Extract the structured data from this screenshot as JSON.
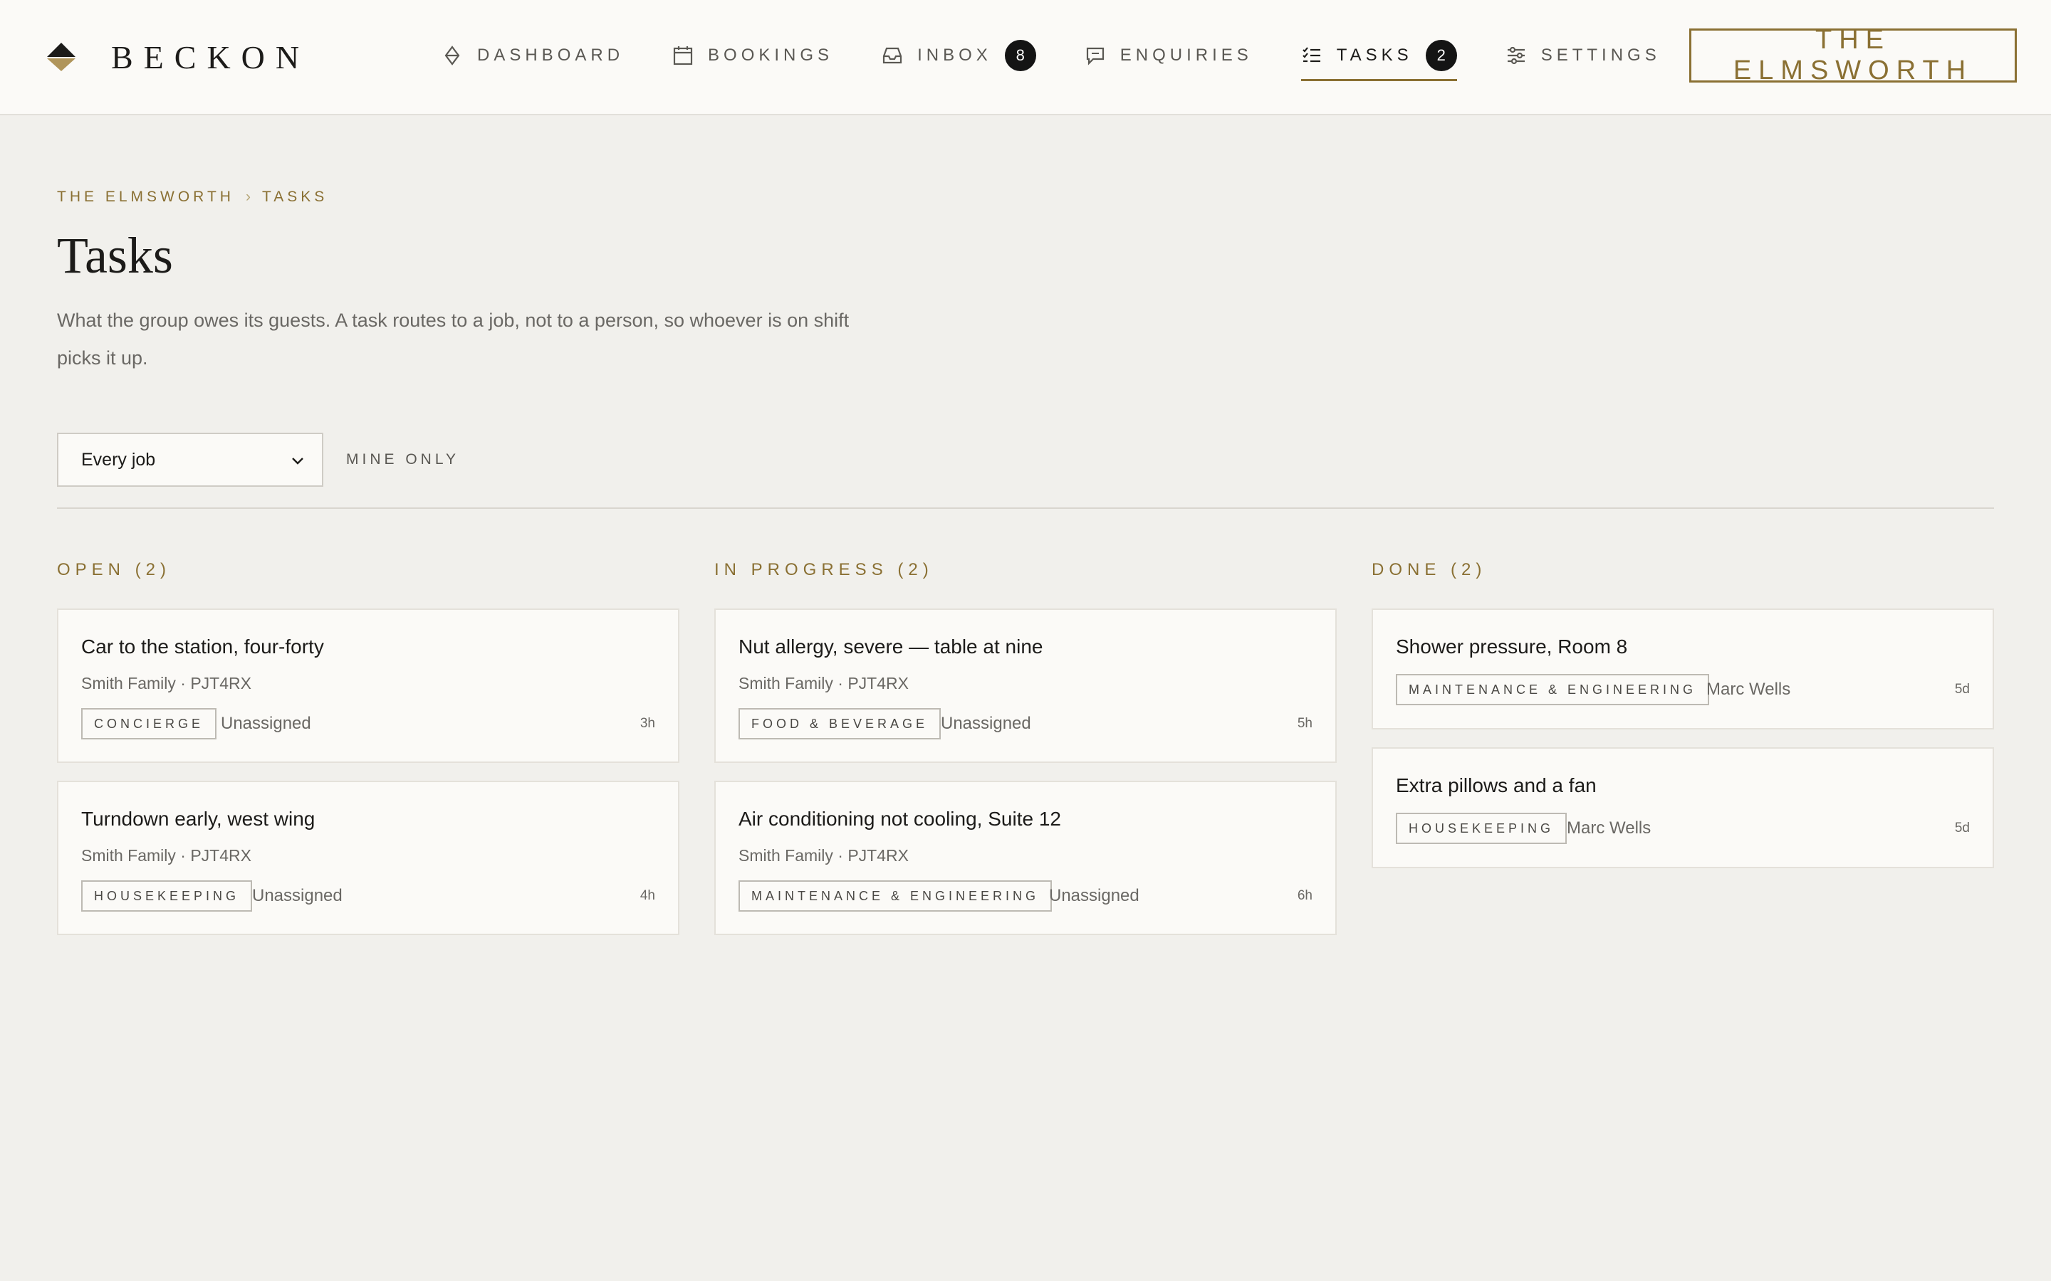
{
  "brand": {
    "name": "BECKON",
    "icon": "diamond-logo-icon"
  },
  "nav": {
    "items": [
      {
        "label": "DASHBOARD",
        "icon": "diamond-outline-icon"
      },
      {
        "label": "BOOKINGS",
        "icon": "calendar-icon"
      },
      {
        "label": "INBOX",
        "icon": "inbox-tray-icon",
        "badge": "8"
      },
      {
        "label": "ENQUIRIES",
        "icon": "chat-bubble-icon"
      },
      {
        "label": "TASKS",
        "icon": "checklist-icon",
        "badge": "2",
        "active": true
      },
      {
        "label": "SETTINGS",
        "icon": "sliders-icon"
      }
    ],
    "property_button": "THE ELMSWORTH"
  },
  "breadcrumb": {
    "parent": "THE ELMSWORTH",
    "separator": "›",
    "current": "TASKS"
  },
  "page": {
    "title": "Tasks",
    "description": "What the group owes its guests. A task routes to a job, not to a person, so whoever is on shift picks it up."
  },
  "filters": {
    "job_select_value": "Every job",
    "mine_only_label": "MINE ONLY"
  },
  "columns": [
    {
      "heading": "OPEN (2)",
      "cards": [
        {
          "title": "Car to the station, four-forty",
          "meta": "Smith Family · PJT4RX",
          "tag": "CONCIERGE",
          "assignee": "Unassigned",
          "age": "3h"
        },
        {
          "title": "Turndown early, west wing",
          "meta": "Smith Family · PJT4RX",
          "tag": "HOUSEKEEPING",
          "assignee": "Unassigned",
          "age": "4h"
        }
      ]
    },
    {
      "heading": "IN PROGRESS (2)",
      "cards": [
        {
          "title": "Nut allergy, severe — table at nine",
          "meta": "Smith Family · PJT4RX",
          "tag": "FOOD & BEVERAGE",
          "assignee": "Unassigned",
          "age": "5h"
        },
        {
          "title": "Air conditioning not cooling, Suite 12",
          "meta": "Smith Family · PJT4RX",
          "tag": "MAINTENANCE & ENGINEERING",
          "assignee": "Unassigned",
          "age": "6h"
        }
      ]
    },
    {
      "heading": "DONE (2)",
      "cards": [
        {
          "title": "Shower pressure, Room 8",
          "tag": "MAINTENANCE & ENGINEERING",
          "assignee": "Marc Wells",
          "age": "5d"
        },
        {
          "title": "Extra pillows and a fan",
          "tag": "HOUSEKEEPING",
          "assignee": "Marc Wells",
          "age": "5d"
        }
      ]
    }
  ],
  "colors": {
    "accent": "#8a7033",
    "background": "#f1f0ec",
    "card": "#fbfaf7",
    "badge": "#141414"
  }
}
